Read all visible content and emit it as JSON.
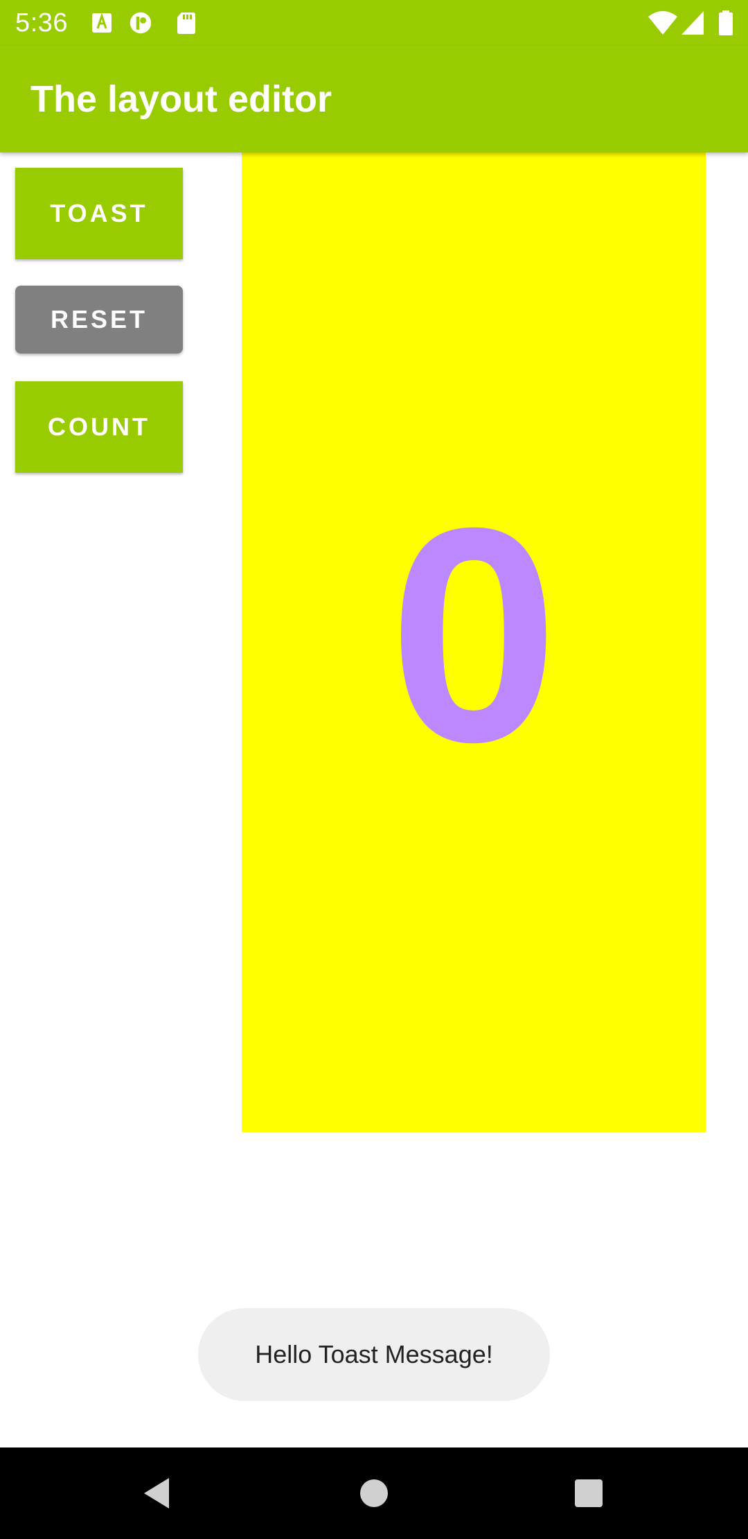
{
  "status_bar": {
    "time": "5:36",
    "icons_left": [
      "a-icon",
      "p-icon",
      "sd-card-icon"
    ],
    "icons_right": [
      "wifi-icon",
      "signal-icon",
      "battery-icon"
    ]
  },
  "app_bar": {
    "title": "The layout editor"
  },
  "buttons": {
    "toast": "TOAST",
    "reset": "RESET",
    "count": "COUNT"
  },
  "counter": {
    "value": "0"
  },
  "toast": {
    "message": "Hello Toast Message!"
  },
  "navigation": {
    "icons": [
      "back-icon",
      "home-icon",
      "recents-icon"
    ]
  },
  "colors": {
    "accent": "#99cc00",
    "reset_button": "#808080",
    "counter_background": "#ffff00",
    "counter_text": "#bb88ff",
    "toast_background": "#efefef"
  }
}
